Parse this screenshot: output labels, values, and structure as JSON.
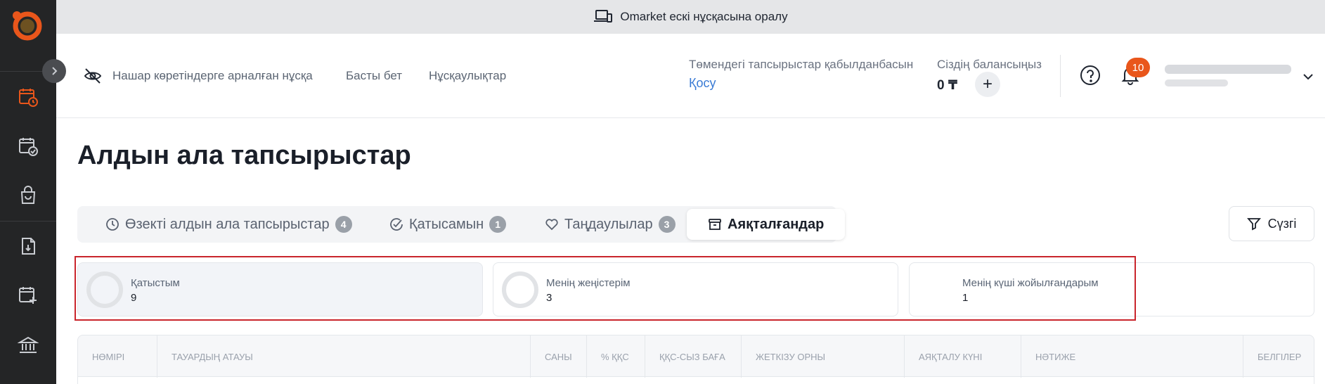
{
  "banner": {
    "text": "Omarket ескі нұсқасына оралу",
    "icon": "devices-icon"
  },
  "header": {
    "accessibility_label": "Нашар көретіндерге арналған нұсқа",
    "nav": [
      "Басты бет",
      "Нұсқаулықтар"
    ],
    "notice_text": "Төмендегі тапсырыстар қабылданбасын",
    "notice_link": "Қосу",
    "balance_title": "Сіздің балансыңыз",
    "balance_value": "0 ₸",
    "notifications_count": "10"
  },
  "sidebar": {
    "icons": [
      "calendar-clock-icon",
      "calendar-check-icon",
      "shopping-bag-icon",
      "document-download-icon",
      "calendar-plus-icon",
      "bank-icon"
    ],
    "active_color": "#e9561b"
  },
  "page": {
    "title": "Алдын ала тапсырыстар"
  },
  "tabs": [
    {
      "label": "Өзекті алдын ала тапсырыстар",
      "count": "4",
      "icon": "clock-icon"
    },
    {
      "label": "Қатысамын",
      "count": "1",
      "icon": "check-circle-icon"
    },
    {
      "label": "Таңдаулылар",
      "count": "3",
      "icon": "heart-icon"
    },
    {
      "label": "Аяқталғандар",
      "icon": "archive-icon"
    }
  ],
  "filter": {
    "label": "Сүзгі"
  },
  "stats": [
    {
      "label": "Қатыстым",
      "value": "9"
    },
    {
      "label": "Менің жеңістерім",
      "value": "3"
    },
    {
      "label": "Менің күші жойылғандарым",
      "value": "1"
    }
  ],
  "table": {
    "columns": [
      "НӨМІРІ",
      "ТАУАРДЫҢ АТАУЫ",
      "САНЫ",
      "% ҚҚС",
      "ҚҚС-СЫЗ БАҒА",
      "ЖЕТКІЗУ ОРНЫ",
      "АЯҚТАЛУ КҮНІ",
      "НӘТИЖЕ",
      "БЕЛГІЛЕР"
    ]
  },
  "colors": {
    "brand": "#e9561b",
    "link": "#3a7bd5",
    "highlight": "#c9252c"
  }
}
